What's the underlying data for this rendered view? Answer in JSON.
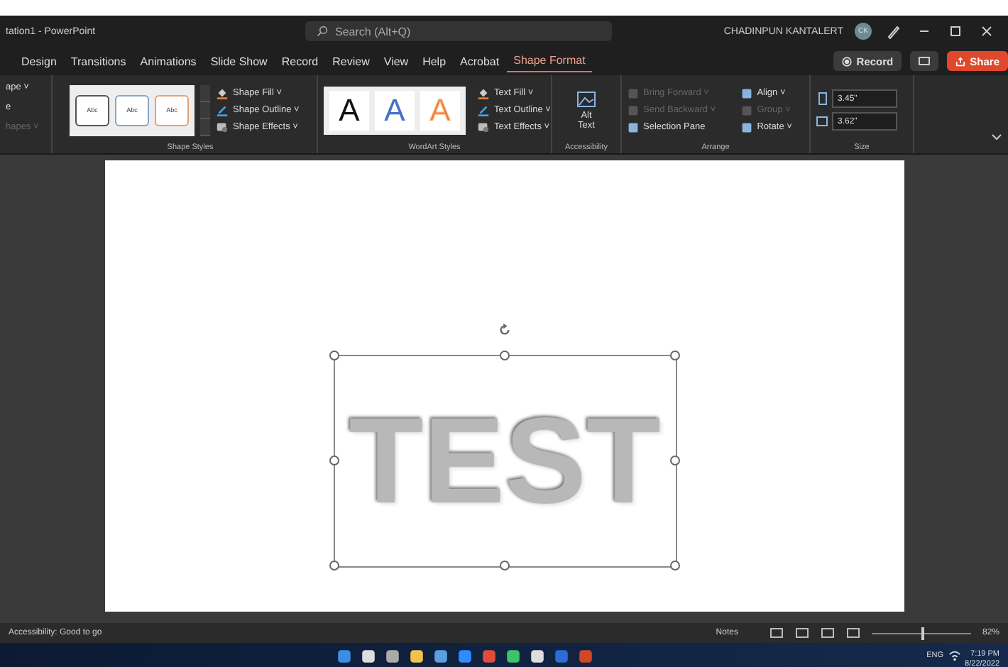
{
  "title_bar": {
    "document_title": "tation1 - PowerPoint",
    "search_placeholder": "Search (Alt+Q)",
    "user_name": "CHADINPUN KANTALERT",
    "avatar_initials": "CK"
  },
  "tabs": [
    {
      "label": "Design",
      "selected": false
    },
    {
      "label": "Transitions",
      "selected": false
    },
    {
      "label": "Animations",
      "selected": false
    },
    {
      "label": "Slide Show",
      "selected": false
    },
    {
      "label": "Record",
      "selected": false
    },
    {
      "label": "Review",
      "selected": false
    },
    {
      "label": "View",
      "selected": false
    },
    {
      "label": "Help",
      "selected": false
    },
    {
      "label": "Acrobat",
      "selected": false
    },
    {
      "label": "Shape Format",
      "selected": true
    }
  ],
  "header_buttons": [
    {
      "label": "Record",
      "kind": "record"
    },
    {
      "label": "Share",
      "kind": "share"
    }
  ],
  "ribbon": {
    "insert_shapes": [
      {
        "label": "ape ˅",
        "disabled": false
      },
      {
        "label": "e",
        "disabled": false
      },
      {
        "label": "hapes ˅",
        "disabled": true
      }
    ],
    "shape_styles": {
      "label": "Shape Styles",
      "swatches": [
        {
          "text": "Abc",
          "color": "#555555"
        },
        {
          "text": "Abc",
          "color": "#8aa4c8"
        },
        {
          "text": "Abc",
          "color": "#e8a070"
        }
      ],
      "commands": [
        {
          "label": "Shape Fill ˅",
          "kind": "fill"
        },
        {
          "label": "Shape Outline ˅",
          "kind": "outline"
        },
        {
          "label": "Shape Effects ˅",
          "kind": "effects"
        }
      ]
    },
    "wordart_styles": {
      "label": "WordArt Styles",
      "swatches": [
        {
          "text": "A",
          "color": "#111111"
        },
        {
          "text": "A",
          "color": "#4472c4"
        },
        {
          "text": "A",
          "color": "#ed7d31"
        }
      ],
      "commands": [
        {
          "label": "Text Fill ˅",
          "kind": "fill"
        },
        {
          "label": "Text Outline ˅",
          "kind": "outline"
        },
        {
          "label": "Text Effects ˅",
          "kind": "effects"
        }
      ]
    },
    "accessibility": {
      "label": "Accessibility",
      "button": "Alt Text"
    },
    "arrange": {
      "label": "Arrange",
      "commands": [
        {
          "label": "Bring Forward ˅",
          "disabled": true
        },
        {
          "label": "Align ˅",
          "disabled": false
        },
        {
          "label": "Send Backward ˅",
          "disabled": true
        },
        {
          "label": "Group ˅",
          "disabled": true
        },
        {
          "label": "Selection Pane",
          "disabled": false
        },
        {
          "label": "Rotate ˅",
          "disabled": false
        }
      ]
    },
    "size": {
      "label": "Size",
      "fields": [
        {
          "value": "3.45\"",
          "kind": "height"
        },
        {
          "value": "3.62\"",
          "kind": "width"
        }
      ]
    }
  },
  "slide": {
    "text": "TEST"
  },
  "status_bar": {
    "accessibility": "Accessibility: Good to go",
    "notes": "Notes",
    "zoom": {
      "level": 0.5
    },
    "zoom_reading": "82%"
  },
  "taskbar": {
    "language": "ENG",
    "time": "7:19 PM",
    "date": "8/22/2022"
  }
}
